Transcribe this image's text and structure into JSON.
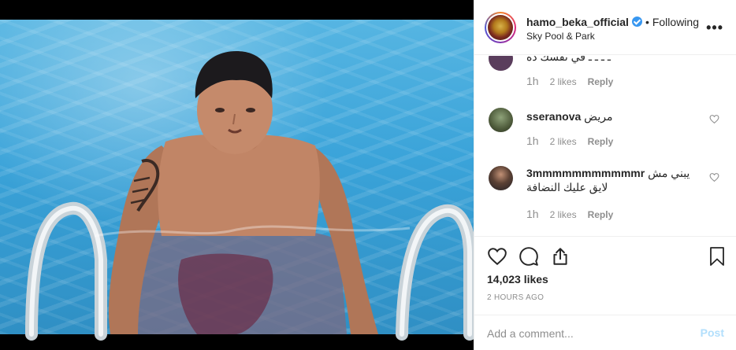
{
  "post": {
    "username": "hamo_beka_official",
    "follow_state": "Following",
    "separator": "•",
    "location": "Sky Pool & Park",
    "more_icon": "more-options-icon"
  },
  "comments": [
    {
      "username": "",
      "text": "ـ ـ ـ ـ في نفسك ده",
      "time": "1h",
      "likes": "2 likes",
      "reply": "Reply"
    },
    {
      "username": "sseranova",
      "text": "مريض",
      "time": "1h",
      "likes": "2 likes",
      "reply": "Reply"
    },
    {
      "username": "3mmmmmmmmmmmr",
      "text": "يبني مش",
      "text_line2": "لايق عليك النضافة",
      "time": "1h",
      "likes": "2 likes",
      "reply": "Reply"
    }
  ],
  "actions": {
    "like_icon": "heart-icon",
    "comment_icon": "comment-icon",
    "share_icon": "share-icon",
    "save_icon": "bookmark-icon"
  },
  "likes_count": "14,023 likes",
  "timestamp": "2 HOURS AGO",
  "add_comment": {
    "placeholder": "Add a comment...",
    "post_label": "Post"
  },
  "colors": {
    "verified": "#3897f0",
    "post_disabled": "#b2dffc",
    "muted_text": "#8e8e8e",
    "pool": "#3aa3d9"
  }
}
